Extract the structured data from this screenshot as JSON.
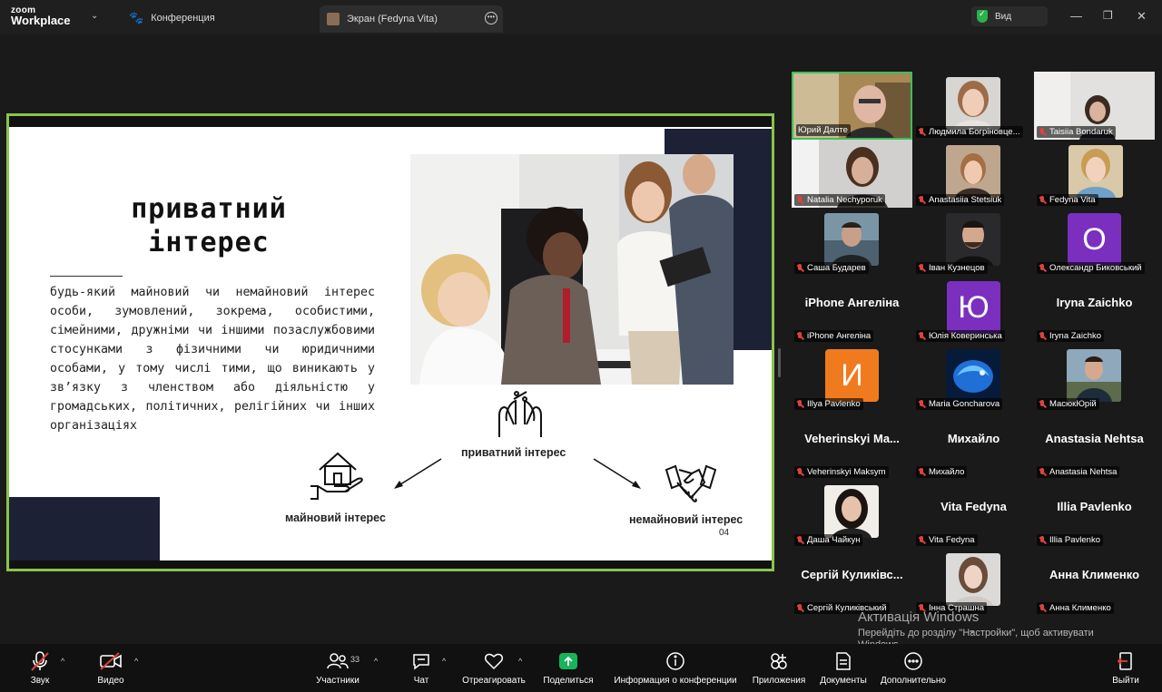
{
  "titlebar": {
    "logo_top": "zoom",
    "logo_bottom": "Workplace",
    "meeting_title": "Конференция",
    "share_tab_label": "Экран (Fedyna Vita)",
    "view_label": "Вид"
  },
  "slide": {
    "title_line1": "приватний",
    "title_line2": "інтерес",
    "body": "будь-який майновий чи немайновий інтерес особи, зумовлений, зокрема, особистими, сімейними, дружніми чи іншими позаслужбовими стосунками з фізичними чи юридичними особами, у тому числі тими, що виникають у зв’язку з членством або діяльністю у громадських, політичних, релігійних чи інших організаціях",
    "diagram_center": "приватний інтерес",
    "diagram_left": "майновий інтерес",
    "diagram_right": "немайновий інтерес",
    "page_number": "04"
  },
  "participants": [
    {
      "name": "Юрий Далте",
      "kind": "video",
      "active": true
    },
    {
      "name": "Людмила Богріновце...",
      "kind": "video"
    },
    {
      "name": "Taisiia Bondaruk",
      "kind": "video"
    },
    {
      "name": "Natalia Nechyporuk",
      "kind": "video"
    },
    {
      "name": "Anastasiia Stetsiuk",
      "kind": "video"
    },
    {
      "name": "Fedyna Vita",
      "kind": "video"
    },
    {
      "name": "Саша Бударев",
      "kind": "video"
    },
    {
      "name": "Іван Кузнецов",
      "kind": "video"
    },
    {
      "name": "Олександр Биковський",
      "kind": "letter",
      "letter": "O",
      "color": "#7b2fbf"
    },
    {
      "name": "iPhone Ангеліна",
      "kind": "text",
      "big": "iPhone Ангеліна"
    },
    {
      "name": "Юлія Коверинська",
      "kind": "letter",
      "letter": "Ю",
      "color": "#7b2fbf"
    },
    {
      "name": "Iryna Zaichko",
      "kind": "text",
      "big": "Iryna Zaichko"
    },
    {
      "name": "Illya Pavlenko",
      "kind": "letter",
      "letter": "И",
      "color": "#f07b1e"
    },
    {
      "name": "Maria Goncharova",
      "kind": "video"
    },
    {
      "name": "МасюкЮрій",
      "kind": "video"
    },
    {
      "name": "Veherinskyi Maksym",
      "kind": "text",
      "big": "Veherinskyi  Ma..."
    },
    {
      "name": "Михайло",
      "kind": "text",
      "big": "Михайло"
    },
    {
      "name": "Anastasia Nehtsa",
      "kind": "text",
      "big": "Anastasia Nehtsa"
    },
    {
      "name": "Даша Чайкун",
      "kind": "video"
    },
    {
      "name": "Vita Fedyna",
      "kind": "text",
      "big": "Vita Fedyna"
    },
    {
      "name": "Illia Pavlenko",
      "kind": "text",
      "big": "Illia Pavlenko"
    },
    {
      "name": "Сергій Куликівський",
      "kind": "text",
      "big": "Сергій  Куликівс..."
    },
    {
      "name": "Інна Страшна",
      "kind": "video"
    },
    {
      "name": "Анна Клименко",
      "kind": "text",
      "big": "Анна Клименко"
    }
  ],
  "activation": {
    "line1": "Активація Windows",
    "line2": "Перейдіть до розділу \"Настройки\", щоб активувати",
    "line3": "Windows."
  },
  "toolbar": {
    "audio": "Звук",
    "video": "Видео",
    "participants": "Участники",
    "participants_count": "33",
    "chat": "Чат",
    "react": "Отреагировать",
    "share": "Поделиться",
    "info": "Информация о конференции",
    "apps": "Приложения",
    "docs": "Документы",
    "more": "Дополнительно",
    "leave": "Выйти"
  },
  "colors": {
    "active_speaker": "#3fbd5b",
    "slide_border": "#8bc34a",
    "mic_muted": "#e0413c",
    "share_green": "#19b35a",
    "slide_navy": "#1c2135"
  }
}
